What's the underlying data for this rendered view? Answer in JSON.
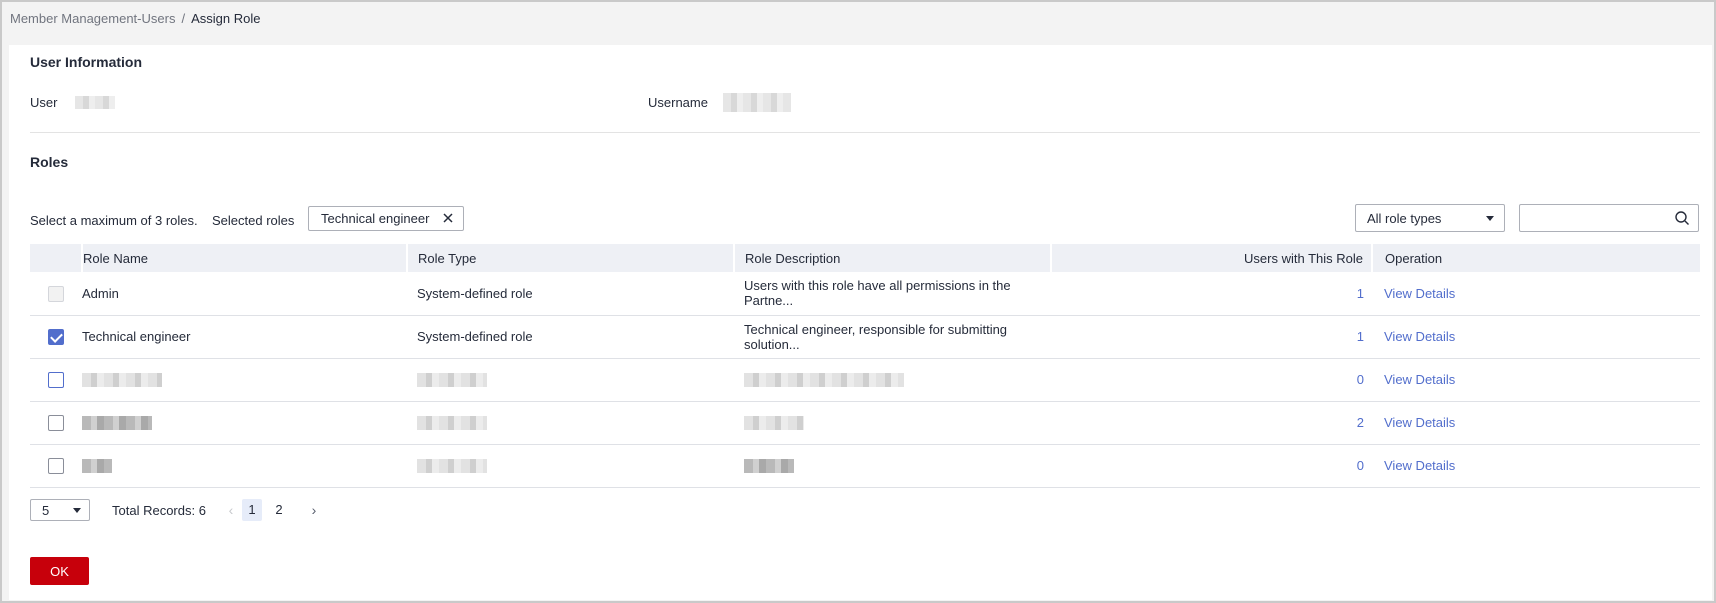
{
  "breadcrumb": {
    "parent": "Member Management-Users",
    "separator": "/",
    "current": "Assign Role"
  },
  "user_info": {
    "title": "User Information",
    "user_label": "User",
    "username_label": "Username"
  },
  "roles": {
    "title": "Roles",
    "hint": "Select a maximum of 3  roles.",
    "selected_label": "Selected roles",
    "selected_tags": [
      "Technical engineer"
    ],
    "filter": {
      "value": "All role types"
    },
    "search": {
      "value": ""
    }
  },
  "table": {
    "headers": {
      "name": "Role Name",
      "type": "Role Type",
      "description": "Role Description",
      "users": "Users with This Role",
      "operation": "Operation"
    },
    "rows": [
      {
        "name": "Admin",
        "type": "System-defined role",
        "description": "Users with this role have all permissions in the Partne...",
        "users": "1",
        "operation": "View Details",
        "checked": false,
        "disabled": true
      },
      {
        "name": "Technical engineer",
        "type": "System-defined role",
        "description": "Technical engineer, responsible for submitting solution...",
        "users": "1",
        "operation": "View Details",
        "checked": true,
        "disabled": false
      },
      {
        "name": "",
        "type": "",
        "description": "",
        "users": "0",
        "operation": "View Details",
        "checked": false,
        "disabled": false
      },
      {
        "name": "",
        "type": "",
        "description": "",
        "users": "2",
        "operation": "View Details",
        "checked": false,
        "disabled": false
      },
      {
        "name": "",
        "type": "",
        "description": "",
        "users": "0",
        "operation": "View Details",
        "checked": false,
        "disabled": false
      }
    ]
  },
  "pagination": {
    "page_size": "5",
    "total": "Total Records: 6",
    "pages": [
      "1",
      "2"
    ],
    "current_page": "1"
  },
  "actions": {
    "ok": "OK"
  },
  "colors": {
    "primary": "#c7000b",
    "link": "#526ecc",
    "header_bg": "#eef0f5"
  }
}
